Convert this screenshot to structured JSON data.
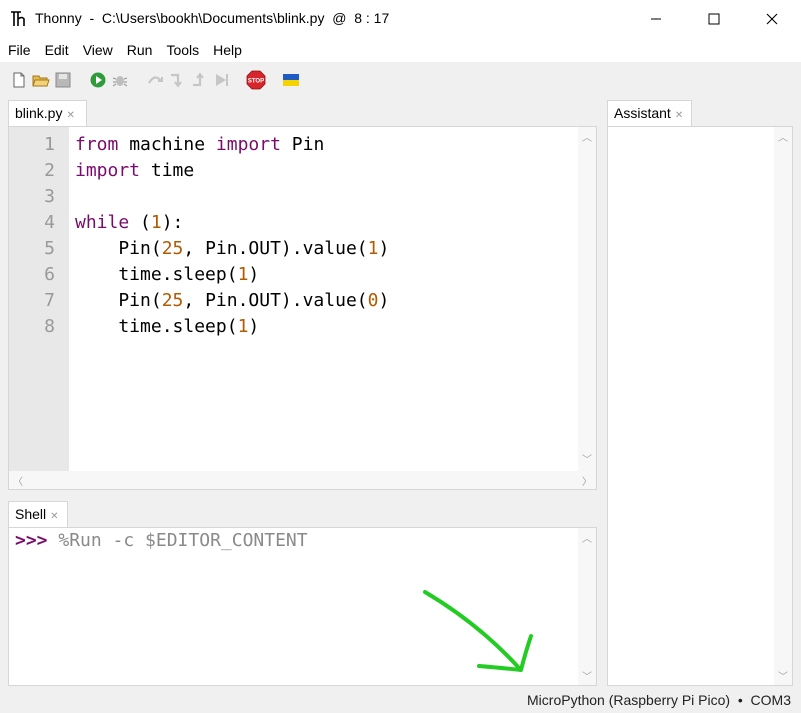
{
  "window": {
    "title": "Thonny  -  C:\\Users\\bookh\\Documents\\blink.py  @  8 : 17"
  },
  "menu": [
    "File",
    "Edit",
    "View",
    "Run",
    "Tools",
    "Help"
  ],
  "toolbar": {
    "icons": [
      "new-file-icon",
      "open-file-icon",
      "save-icon",
      "run-icon",
      "debug-icon",
      "step-over-icon",
      "step-into-icon",
      "step-out-icon",
      "resume-icon",
      "stop-icon",
      "ukraine-flag-icon"
    ],
    "stop_label": "STOP"
  },
  "editor": {
    "tab_label": "blink.py",
    "line_numbers": [
      "1",
      "2",
      "3",
      "4",
      "5",
      "6",
      "7",
      "8"
    ],
    "lines": [
      [
        {
          "t": "from",
          "c": "kw"
        },
        {
          "t": " machine ",
          "c": ""
        },
        {
          "t": "import",
          "c": "kw"
        },
        {
          "t": " Pin",
          "c": ""
        }
      ],
      [
        {
          "t": "import",
          "c": "kw"
        },
        {
          "t": " time",
          "c": ""
        }
      ],
      [],
      [
        {
          "t": "while",
          "c": "kw"
        },
        {
          "t": " (",
          "c": ""
        },
        {
          "t": "1",
          "c": "num"
        },
        {
          "t": "):",
          "c": ""
        }
      ],
      [
        {
          "t": "    Pin(",
          "c": ""
        },
        {
          "t": "25",
          "c": "num"
        },
        {
          "t": ", Pin.OUT).value(",
          "c": ""
        },
        {
          "t": "1",
          "c": "num"
        },
        {
          "t": ")",
          "c": ""
        }
      ],
      [
        {
          "t": "    time.sleep(",
          "c": ""
        },
        {
          "t": "1",
          "c": "num"
        },
        {
          "t": ")",
          "c": ""
        }
      ],
      [
        {
          "t": "    Pin(",
          "c": ""
        },
        {
          "t": "25",
          "c": "num"
        },
        {
          "t": ", Pin.OUT).value(",
          "c": ""
        },
        {
          "t": "0",
          "c": "num"
        },
        {
          "t": ")",
          "c": ""
        }
      ],
      [
        {
          "t": "    time.sleep(",
          "c": ""
        },
        {
          "t": "1",
          "c": "num"
        },
        {
          "t": ")",
          "c": ""
        }
      ]
    ]
  },
  "assistant": {
    "tab_label": "Assistant"
  },
  "shell": {
    "tab_label": "Shell",
    "prompt": ">>>",
    "command": " %Run -c $EDITOR_CONTENT"
  },
  "status": {
    "interpreter": "MicroPython (Raspberry Pi Pico)  •  COM3"
  },
  "colors": {
    "keyword": "#7a0b6d",
    "number": "#b35a00",
    "annotation_arrow": "#22cc22"
  }
}
